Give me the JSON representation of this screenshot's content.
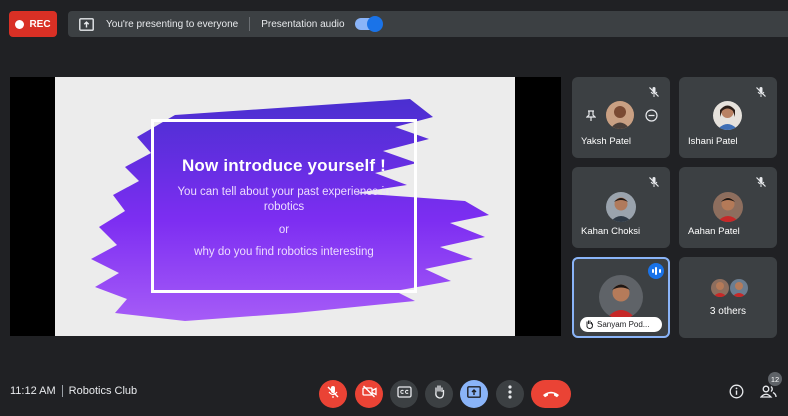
{
  "topbar": {
    "rec_label": "REC",
    "presenting_text": "You're presenting to everyone",
    "audio_label": "Presentation audio",
    "audio_enabled": true
  },
  "slide": {
    "title": "Now introduce yourself !",
    "lines": [
      "You can tell about your past experience in",
      "robotics",
      "or",
      "why do you find robotics interesting"
    ],
    "brush_color": "#7b2ff7"
  },
  "participants": [
    {
      "name": "Yaksh Patel",
      "muted": true
    },
    {
      "name": "Ishani Patel",
      "muted": true
    },
    {
      "name": "Kahan Choksi",
      "muted": true
    },
    {
      "name": "Aahan Patel",
      "muted": true
    },
    {
      "name": "Sanyam Pod...",
      "speaking": true
    },
    {
      "name": "3 others"
    }
  ],
  "bottom": {
    "time": "11:12 AM",
    "meeting_name": "Robotics Club",
    "participant_count": "12"
  },
  "colors": {
    "background": "#202124",
    "tile": "#3c4043",
    "danger": "#ea4335",
    "accent": "#8ab4f8"
  },
  "icons": [
    "record-dot-icon",
    "present-screen-icon",
    "mic-off-icon",
    "camera-off-icon",
    "captions-icon",
    "hand-icon",
    "present-icon",
    "more-icon",
    "end-call-icon",
    "info-icon",
    "people-icon",
    "pin-icon",
    "remove-icon"
  ]
}
